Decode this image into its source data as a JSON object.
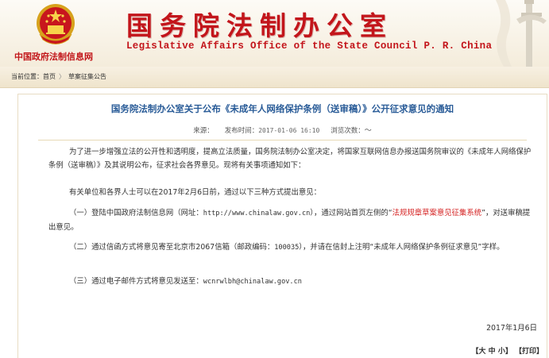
{
  "header": {
    "gov_site_label": "中国政府法制信息网",
    "title_cn": "国务院法制办公室",
    "title_en": "Legislative Affairs Office of the State Council P. R. China"
  },
  "breadcrumb": {
    "prefix": "当前位置：",
    "home": "首页",
    "separator": "〉",
    "current": "草案征集公告"
  },
  "article": {
    "title": "国务院法制办公室关于公布《未成年人网络保护条例（送审稿）》公开征求意见的通知",
    "meta": {
      "source_label": "来源：",
      "published_label": "发布时间：",
      "published_time": "2017-01-06 16:10",
      "views_label": "浏览次数：",
      "views_icon": "～"
    },
    "paragraphs": {
      "p1": "为了进一步增强立法的公开性和透明度，提高立法质量，国务院法制办公室决定，将国家互联网信息办报送国务院审议的《未成年人网络保护条例（送审稿）》及其说明公布，征求社会各界意见。现将有关事项通知如下：",
      "p2": "有关单位和各界人士可以在2017年2月6日前，通过以下三种方式提出意见：",
      "p3_a": "（一）登陆中国政府法制信息网（网址：",
      "p3_url": "http://www.chinalaw.gov.cn",
      "p3_b": "），通过网站首页左侧的“",
      "p3_link": "法规规章草案意见征集系统",
      "p3_c": "”，对送审稿提出意见。",
      "p4_a": "（二）通过信函方式将意见寄至北京市2067信箱（邮政编码：",
      "p4_zip": "100035",
      "p4_b": "），并请在信封上注明“未成年人网络保护条例征求意见”字样。",
      "p5_a": "（三）通过电子邮件方式将意见发送至：",
      "p5_email": "wcnrwlbh@chinalaw.gov.cn"
    },
    "date": "2017年1月6日",
    "tools": {
      "size_open": "【",
      "size_large": "大",
      "size_medium": "中",
      "size_small": "小",
      "size_close": "】",
      "print": "【打印】"
    }
  },
  "colors": {
    "brand_red": "#c3151b",
    "title_blue": "#2a5c98",
    "link_red": "#d42020",
    "banner_bg": "#f4ecdb"
  }
}
